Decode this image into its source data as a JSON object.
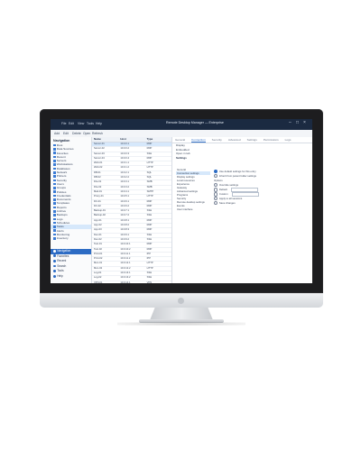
{
  "app": {
    "title": "Remote Desktop Manager — Enterprise",
    "toolbar": [
      "File",
      "Edit",
      "View",
      "Tools",
      "Help"
    ],
    "ribbon": [
      "Add",
      "Edit",
      "Delete",
      "Open",
      "Refresh"
    ],
    "window_controls": [
      "–",
      "□",
      "×"
    ]
  },
  "left": {
    "header": "Navigation",
    "tree": [
      "Root",
      "Data Sources",
      "Favorites",
      "Recent",
      "Servers",
      "Workstations",
      "Databases",
      "Network",
      "Printers",
      "Security",
      "Users",
      "Groups",
      "Policies",
      "Credentials",
      "Documents",
      "Templates",
      "Reports",
      "Archive",
      "Backups",
      "Logs",
      "Schedules",
      "Tasks",
      "Alerts",
      "Monitoring",
      "Inventory",
      "Licenses",
      "Settings",
      "Tools",
      "Scripts",
      "Macros",
      "Sessions",
      "Connections",
      "Gateways",
      "Proxies",
      "VPN",
      "Cloud",
      "Local",
      "Shared",
      "Personal"
    ],
    "nav": [
      "Navigation",
      "Favorites",
      "Recent",
      "Search",
      "Tools",
      "Help"
    ]
  },
  "grid": {
    "columns": [
      "Name",
      "Host",
      "Type"
    ],
    "rows": [
      [
        "Server-01",
        "10.0.0.1",
        "RDP"
      ],
      [
        "Server-02",
        "10.0.0.2",
        "RDP"
      ],
      [
        "Server-03",
        "10.0.0.3",
        "SSH"
      ],
      [
        "Server-04",
        "10.0.0.4",
        "RDP"
      ],
      [
        "Web-01",
        "10.0.1.1",
        "HTTP"
      ],
      [
        "Web-02",
        "10.0.1.2",
        "HTTP"
      ],
      [
        "DB-01",
        "10.0.2.1",
        "SQL"
      ],
      [
        "DB-02",
        "10.0.2.2",
        "SQL"
      ],
      [
        "File-01",
        "10.0.3.1",
        "SMB"
      ],
      [
        "File-02",
        "10.0.3.2",
        "SMB"
      ],
      [
        "Mail-01",
        "10.0.4.1",
        "SMTP"
      ],
      [
        "Proxy-01",
        "10.0.5.1",
        "HTTP"
      ],
      [
        "DC-01",
        "10.0.6.1",
        "RDP"
      ],
      [
        "DC-02",
        "10.0.6.2",
        "RDP"
      ],
      [
        "Backup-01",
        "10.0.7.1",
        "SSH"
      ],
      [
        "Backup-02",
        "10.0.7.2",
        "SSH"
      ],
      [
        "App-01",
        "10.0.8.1",
        "RDP"
      ],
      [
        "App-02",
        "10.0.8.2",
        "RDP"
      ],
      [
        "App-03",
        "10.0.8.3",
        "RDP"
      ],
      [
        "Dev-01",
        "10.0.9.1",
        "SSH"
      ],
      [
        "Dev-02",
        "10.0.9.2",
        "SSH"
      ],
      [
        "Test-01",
        "10.0.10.1",
        "RDP"
      ],
      [
        "Test-02",
        "10.0.10.2",
        "RDP"
      ],
      [
        "Print-01",
        "10.0.11.1",
        "IPP"
      ],
      [
        "Print-02",
        "10.0.11.2",
        "IPP"
      ],
      [
        "Mon-01",
        "10.0.12.1",
        "HTTP"
      ],
      [
        "Mon-02",
        "10.0.12.2",
        "HTTP"
      ],
      [
        "Log-01",
        "10.0.13.1",
        "SSH"
      ],
      [
        "Log-02",
        "10.0.13.2",
        "SSH"
      ],
      [
        "VPN-01",
        "10.0.14.1",
        "VPN"
      ],
      [
        "VPN-02",
        "10.0.14.2",
        "VPN"
      ],
      [
        "Edge-01",
        "10.0.15.1",
        "SSH"
      ],
      [
        "Edge-02",
        "10.0.15.2",
        "SSH"
      ],
      [
        "Core-01",
        "10.0.16.1",
        "RDP"
      ],
      [
        "Core-02",
        "10.0.16.2",
        "RDP"
      ]
    ]
  },
  "details": {
    "tabs": [
      "General",
      "Connection",
      "Security",
      "Advanced",
      "Settings",
      "Permissions",
      "Logs"
    ],
    "props": [
      "Display",
      "Embedded",
      "Open in tab"
    ],
    "section_head": "Settings",
    "settings": [
      "General",
      "Connection settings",
      "Display settings",
      "Local resources",
      "Experience",
      "Gateway",
      "Advanced settings",
      "Programs",
      "Security",
      "Remote desktop settings",
      "Events",
      "User interface"
    ],
    "options": [
      "Use default settings for this entry",
      "Inherit from parent folder settings",
      "Options",
      "Override settings",
      "Default",
      "Custom",
      "Apply to all sessions",
      "Save changes"
    ]
  }
}
